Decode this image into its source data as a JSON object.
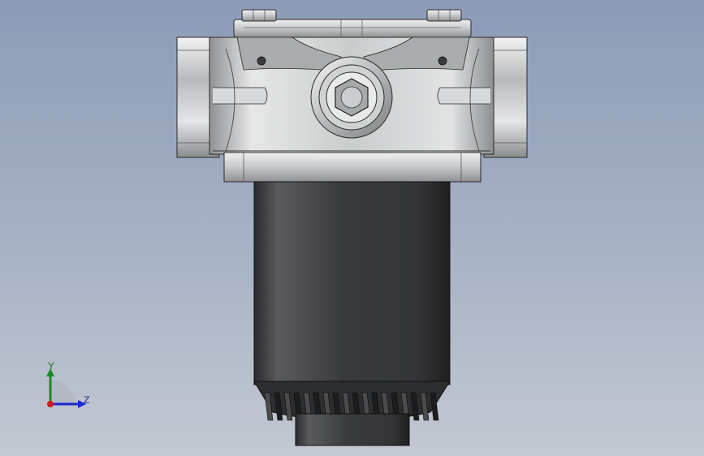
{
  "viewport": {
    "background_top": "#8c9bb6",
    "background_bottom": "#c3c8d1"
  },
  "model": {
    "part_icon": "filter-housing-3d-model",
    "body_color": "#c8cacc",
    "bowl_color": "#3c3d3f"
  },
  "triad": {
    "y_label": "Y",
    "z_label": "Z",
    "y_color": "#1d8a2a",
    "z_color": "#1a2ad0",
    "x_color": "#d01a1a"
  }
}
